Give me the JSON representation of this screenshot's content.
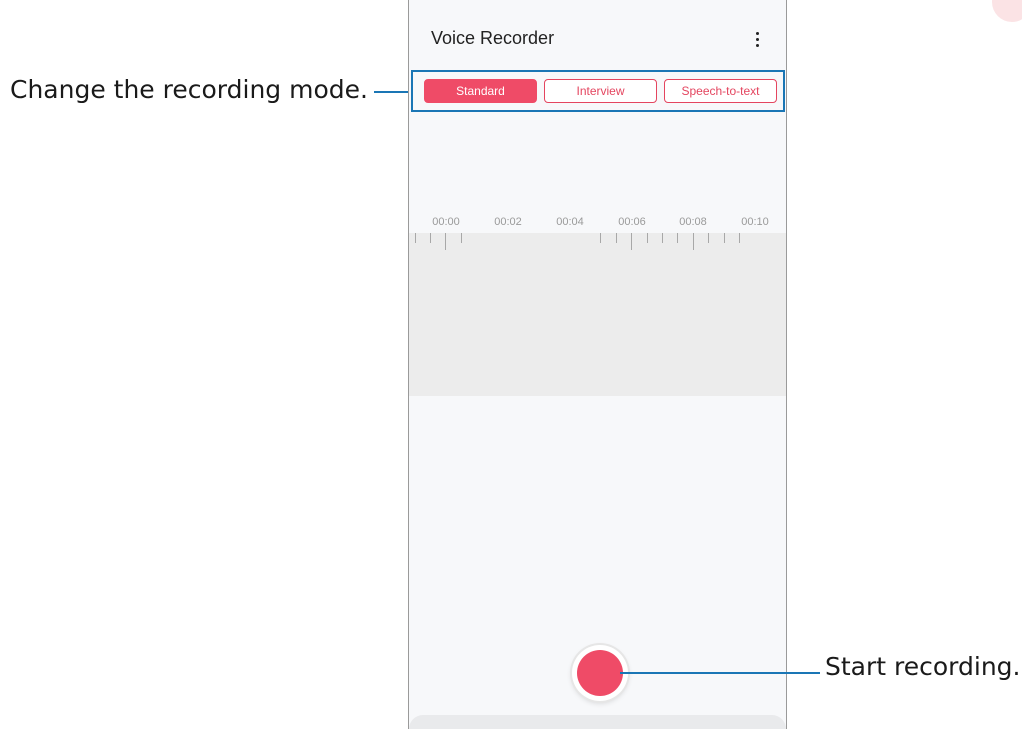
{
  "app": {
    "title": "Voice Recorder",
    "more_icon": "more-vertical-icon"
  },
  "modes": {
    "tabs": [
      {
        "label": "Standard",
        "active": true
      },
      {
        "label": "Interview",
        "active": false
      },
      {
        "label": "Speech-to-text",
        "active": false
      }
    ]
  },
  "timeline": {
    "labels": [
      "00:00",
      "00:02",
      "00:04",
      "00:06",
      "00:08",
      "00:10"
    ]
  },
  "record": {
    "icon": "record-icon"
  },
  "callouts": {
    "mode": "Change the recording mode.",
    "record": "Start recording."
  },
  "colors": {
    "accent": "#ef4b67",
    "callout_line": "#1a76b5",
    "wave_bg": "#ececec"
  }
}
